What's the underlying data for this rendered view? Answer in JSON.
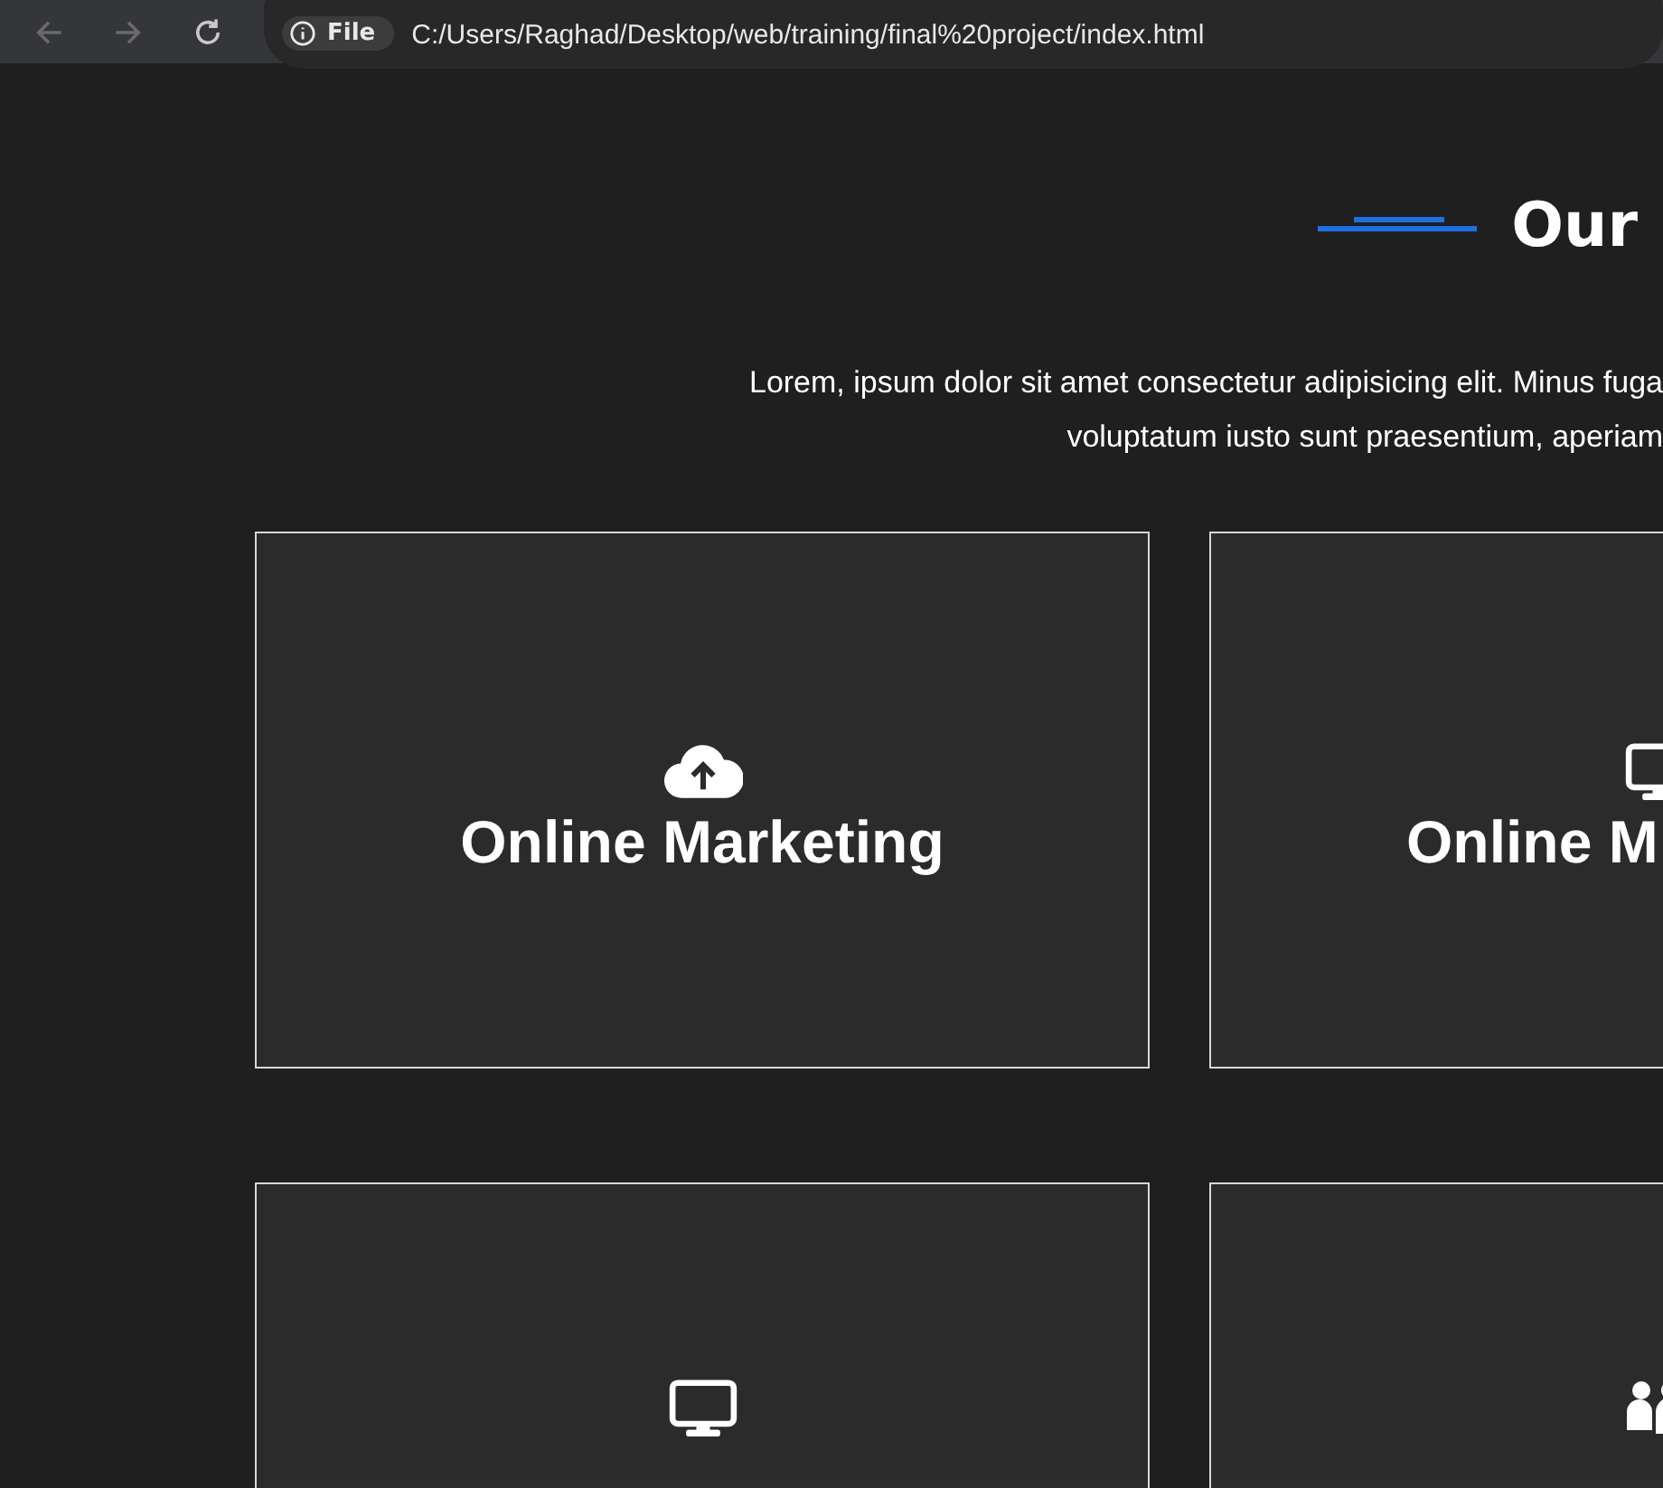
{
  "browser": {
    "site_chip": "File",
    "url": "C:/Users/Raghad/Desktop/web/training/final%20project/index.html"
  },
  "section": {
    "title": "Our",
    "intro": [
      "Lorem, ipsum dolor sit amet consectetur adipisicing elit. Minus fuga",
      "voluptatum iusto sunt praesentium, aperiam"
    ]
  },
  "cards": [
    {
      "kind": "upload",
      "title": "Online Marketing"
    },
    {
      "kind": "screen",
      "title": "Online M"
    },
    {
      "kind": "screen"
    },
    {
      "kind": "team"
    }
  ]
}
